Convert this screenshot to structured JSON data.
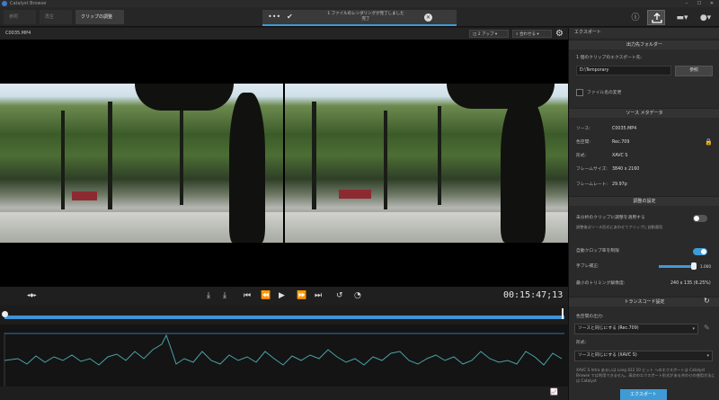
{
  "window": {
    "title": "Catalyst Browse"
  },
  "tabs": [
    {
      "label": "参照"
    },
    {
      "label": "再生"
    },
    {
      "label": "クリップの調整"
    }
  ],
  "notification": {
    "message": "1 ファイルのレンダリングが完了しました",
    "sub": "完了"
  },
  "toolbar": {
    "info_icon": "info-icon",
    "export_icon": "export-icon",
    "briefcase_icon": "briefcase-icon",
    "user_icon": "user-icon"
  },
  "viewer": {
    "filename": "C0035.MP4",
    "layout_label": "2 アップ",
    "fit_label": "合わせる",
    "timecode": "00:15:47;13"
  },
  "panel": {
    "title": "エクスポート",
    "output_section": "出力先フォルダー",
    "export_prompt": "1 個のクリップのエクスポート先:",
    "folder_value": "D:\\Temporary",
    "browse_label": "参照",
    "rename_label": "ファイル名の変更",
    "meta_section": "ソース メタデータ",
    "meta": [
      {
        "k": "ソース:",
        "v": "C0035.MP4"
      },
      {
        "k": "色空間:",
        "v": "Rec.709"
      },
      {
        "k": "形式:",
        "v": "XAVC S"
      },
      {
        "k": "フレームサイズ:",
        "v": "3840 x 2160"
      },
      {
        "k": "フレームレート:",
        "v": "29.97p"
      }
    ],
    "adjust_section": "調整の設定",
    "apply_label": "未分析のクリップに調整を適用する",
    "apply_note": "調整後はソース形式にあわせてクリップに自動適用",
    "autocrop_label": "自動クロップ率を制限",
    "stabilize_label": "手ブレ補正:",
    "stabilize_value": "1.000",
    "min_trim_label": "最小のトリミング解像度:",
    "min_trim_value": "240 x 135 (6.25%)",
    "transcode_section": "トランスコード設定",
    "colorspace_label": "色空間の出力:",
    "colorspace_value": "ソースと同じにする (Rec.709)",
    "format_label": "形式:",
    "format_value": "ソースと同じにする (XAVC S)",
    "note": "XAVC S Intra あるいは Long 422 10 ビット へのエクスポートは Catalyst Browse では利用できません。高次のエクスポート形式がある合わせの使用方法には Catalyst",
    "export_button": "エクスポート"
  }
}
